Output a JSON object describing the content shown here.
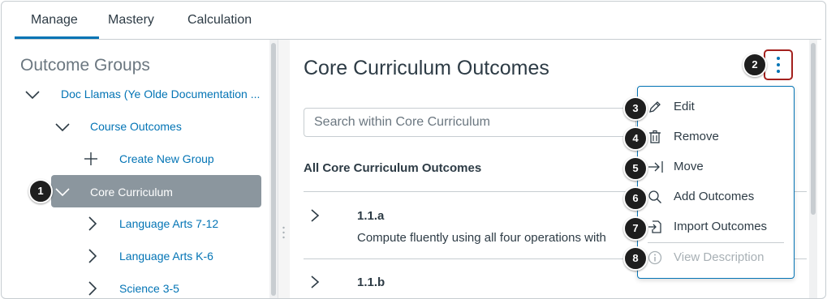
{
  "tabs": [
    {
      "label": "Manage",
      "active": true
    },
    {
      "label": "Mastery",
      "active": false
    },
    {
      "label": "Calculation",
      "active": false
    }
  ],
  "left": {
    "title": "Outcome Groups",
    "tree": [
      {
        "label": "Doc Llamas (Ye Olde Documentation ...",
        "icon": "chevron-down-icon",
        "selected": false
      },
      {
        "label": "Course Outcomes",
        "icon": "chevron-down-icon",
        "selected": false
      },
      {
        "label": "Create New Group",
        "icon": "plus-icon",
        "selected": false
      },
      {
        "label": "Core Curriculum",
        "icon": "chevron-down-icon",
        "selected": true
      },
      {
        "label": "Language Arts 7-12",
        "icon": "chevron-right-icon",
        "selected": false
      },
      {
        "label": "Language Arts K-6",
        "icon": "chevron-right-icon",
        "selected": false
      },
      {
        "label": "Science 3-5",
        "icon": "chevron-right-icon",
        "selected": false
      }
    ]
  },
  "right": {
    "title": "Core Curriculum Outcomes",
    "search_placeholder": "Search within Core Curriculum",
    "section_heading": "All Core Curriculum Outcomes",
    "outcomes": [
      {
        "code": "1.1.a",
        "description": "Compute fluently using all four operations with"
      },
      {
        "code": "1.1.b",
        "description": ""
      }
    ]
  },
  "menu": {
    "items": [
      {
        "label": "Edit",
        "icon": "pencil-icon",
        "disabled": false
      },
      {
        "label": "Remove",
        "icon": "trash-icon",
        "disabled": false
      },
      {
        "label": "Move",
        "icon": "move-icon",
        "disabled": false
      },
      {
        "label": "Add Outcomes",
        "icon": "search-icon",
        "disabled": false
      },
      {
        "label": "Import Outcomes",
        "icon": "import-icon",
        "disabled": false
      },
      {
        "label": "View Description",
        "icon": "info-icon",
        "disabled": true
      }
    ]
  },
  "callouts": [
    "1",
    "2",
    "3",
    "4",
    "5",
    "6",
    "7",
    "8"
  ],
  "colors": {
    "accent": "#0374b5",
    "selected_bg": "#8b969e",
    "callout_border": "#a3201d"
  }
}
